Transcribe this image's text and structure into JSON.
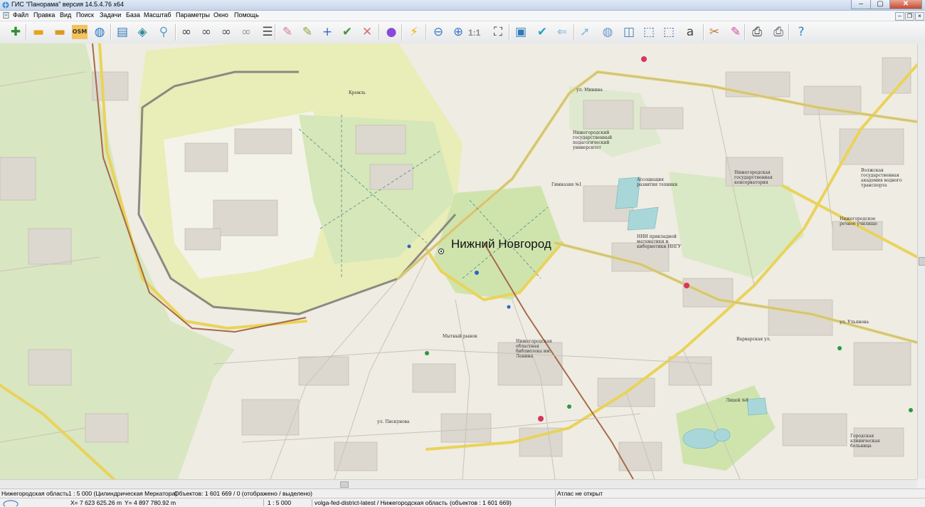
{
  "window": {
    "title": "ГИС \"Панорама\" версия 14.5.4.76 x64",
    "minimize": "–",
    "maximize": "▢",
    "close": "✕"
  },
  "menu": {
    "items": [
      "Файл",
      "Правка",
      "Вид",
      "Поиск",
      "Задачи",
      "База",
      "Масштаб",
      "Параметры",
      "Окно",
      "Помощь"
    ]
  },
  "toolbar": {
    "scale_label": "1:1",
    "buttons": [
      {
        "name": "new-document-icon",
        "glyph": "✚",
        "color": "#2f8f2f"
      },
      {
        "name": "open-folder-icon",
        "glyph": "▬",
        "color": "#e8a21a"
      },
      {
        "name": "open-multiple-icon",
        "glyph": "▬",
        "color": "#d99a1e"
      },
      {
        "name": "open-osm-icon",
        "glyph": "OSM",
        "color": "#d9941a"
      },
      {
        "name": "web-globe-icon",
        "glyph": "◍",
        "color": "#2a78c8"
      },
      {
        "name": "map-layers-icon",
        "glyph": "▤",
        "color": "#3a78b8"
      },
      {
        "name": "layer-stack-icon",
        "glyph": "◈",
        "color": "#2c8c9a"
      },
      {
        "name": "legend-icon",
        "glyph": "⚲",
        "color": "#5aa0c8"
      },
      {
        "name": "binoculars-icon",
        "glyph": "∞",
        "color": "#444"
      },
      {
        "name": "find-text-icon",
        "glyph": "∞",
        "color": "#555"
      },
      {
        "name": "find-more-icon",
        "glyph": "∞",
        "color": "#555"
      },
      {
        "name": "find-area-icon",
        "glyph": "∞",
        "color": "#999"
      },
      {
        "name": "list-icon",
        "glyph": "☰",
        "color": "#444"
      },
      {
        "name": "select-object-icon",
        "glyph": "✎",
        "color": "#d97aa8"
      },
      {
        "name": "edit-object-icon",
        "glyph": "✎",
        "color": "#8aa83a"
      },
      {
        "name": "add-point-icon",
        "glyph": "+",
        "color": "#2a6cc8"
      },
      {
        "name": "accept-edit-icon",
        "glyph": "✔",
        "color": "#3a9a3a"
      },
      {
        "name": "delete-object-icon",
        "glyph": "✕",
        "color": "#e06a6a"
      },
      {
        "name": "palette-icon",
        "glyph": "●",
        "color": "#8a4ad8"
      },
      {
        "name": "lightning-icon",
        "glyph": "⚡",
        "color": "#e8b01a"
      },
      {
        "name": "zoom-out-icon",
        "glyph": "⊖",
        "color": "#3a7ac8"
      },
      {
        "name": "zoom-in-icon",
        "glyph": "⊕",
        "color": "#3a7ac8"
      },
      {
        "name": "fit-window-icon",
        "glyph": "⛶",
        "color": "#444"
      },
      {
        "name": "show-all-icon",
        "glyph": "▣",
        "color": "#2a7ab8"
      },
      {
        "name": "check-icon",
        "glyph": "✔",
        "color": "#2aa0c8"
      },
      {
        "name": "back-arrow-icon",
        "glyph": "⇐",
        "color": "#8ab8d8"
      },
      {
        "name": "cursor-icon",
        "glyph": "➚",
        "color": "#8ab8d8"
      },
      {
        "name": "gps-globe-icon",
        "glyph": "◍",
        "color": "#6a98c8"
      },
      {
        "name": "map-edit-icon",
        "glyph": "◫",
        "color": "#3a7ab8"
      },
      {
        "name": "select-frame-icon",
        "glyph": "⬚",
        "color": "#2a6ab8"
      },
      {
        "name": "info-frame-icon",
        "glyph": "⬚",
        "color": "#2a6ab8"
      },
      {
        "name": "text-frame-icon",
        "glyph": "a",
        "color": "#444"
      },
      {
        "name": "tools-icon",
        "glyph": "✂",
        "color": "#c87a2a"
      },
      {
        "name": "route-icon",
        "glyph": "✎",
        "color": "#d84aa8"
      },
      {
        "name": "print-icon",
        "glyph": "⎙",
        "color": "#333"
      },
      {
        "name": "print-preview-icon",
        "glyph": "⎙",
        "color": "#556"
      },
      {
        "name": "help-icon",
        "glyph": "?",
        "color": "#2a8ac8"
      }
    ]
  },
  "map": {
    "city_label": "Нижний Новгород",
    "labels": [
      "Кремль",
      "Нижегородский государственный педагогический университет",
      "Гимназия №1",
      "Ассоциация развития техники",
      "Нижегородская государственная консерватория",
      "Волжская государственная академия водного транспорта",
      "НИИ прикладной математики и кибернетики ННГУ",
      "Нижегородская областная библиотека им. Ленина",
      "Нижегородское речное училище",
      "Мытный рынок",
      "Лицей №8",
      "Городская клиническая больница",
      "ул. Пискунова",
      "Варварская ул.",
      "ул. Ульянова",
      "ул. Минина"
    ]
  },
  "status": {
    "region_info": "Нижегородская область",
    "scale_info": "1 : 5 000  (Цилиндрическая Меркатора)",
    "objects_info": "Объектов: 1 601 669 / 0  (отображено / выделено)",
    "atlas": "Атлас не открыт",
    "x_coord": "X= 7 623 625.26 m",
    "y_coord": "Y= 4 897 780.92 m",
    "scale_value": "1 : 5 000",
    "layer_info": "volga-fed-district-latest / Нижегородская область",
    "objects_count": "(объектов : 1 601 669)"
  }
}
